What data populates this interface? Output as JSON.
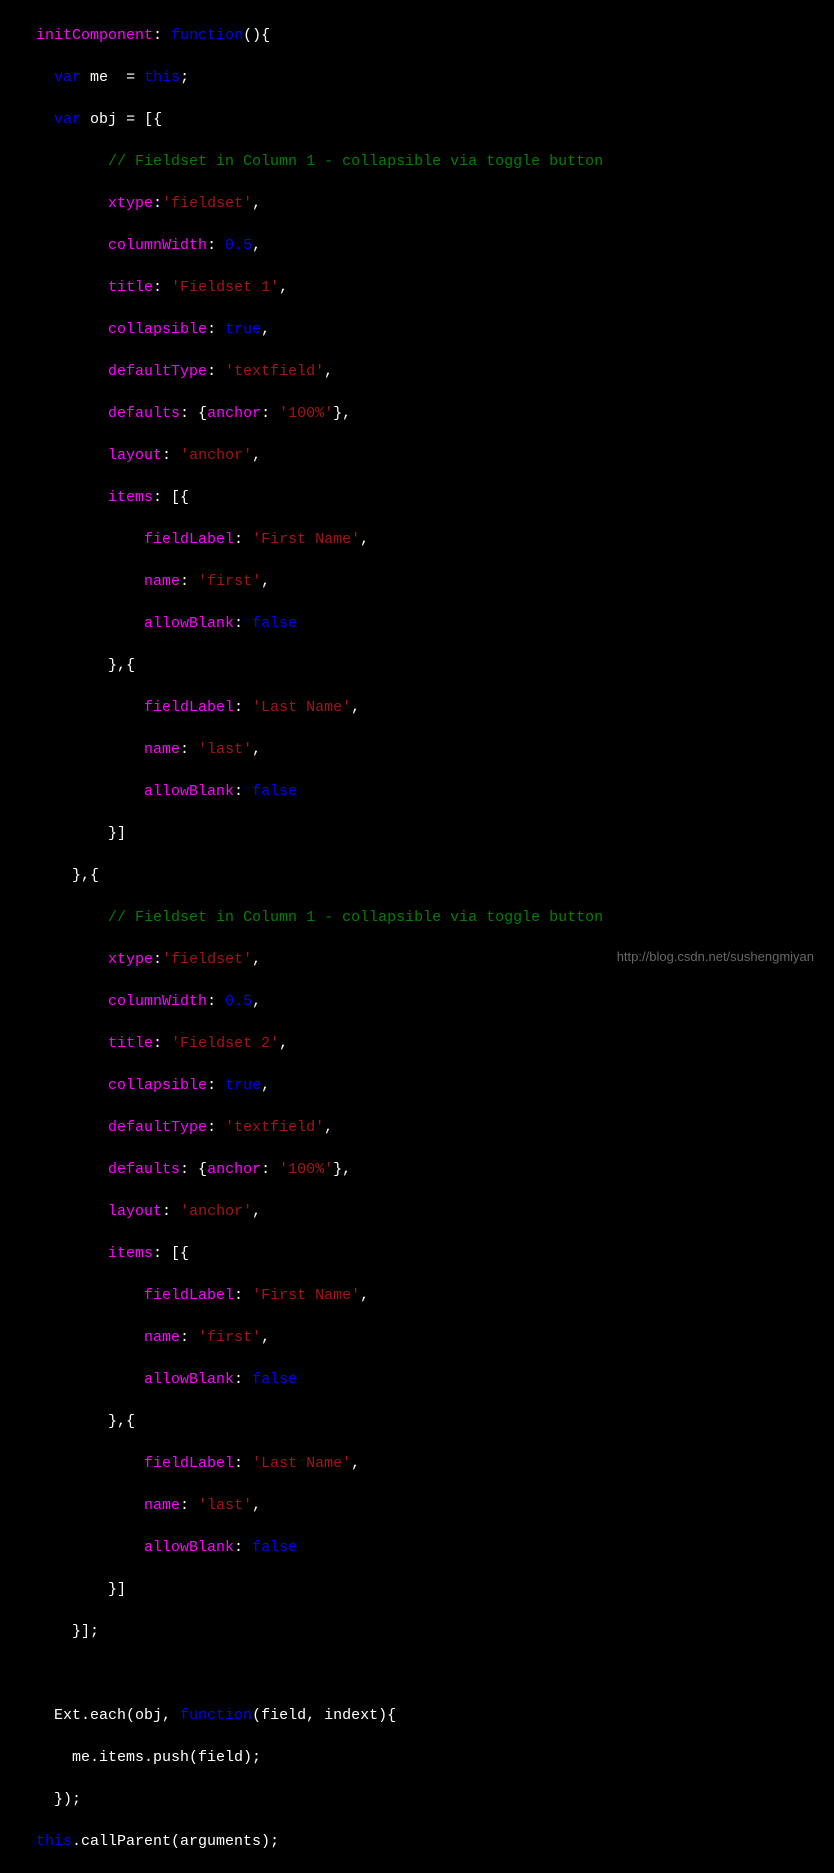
{
  "code": {
    "line1_prop": "initComponent",
    "line1_func": "function",
    "line2_var": "var",
    "line2_me": "me",
    "line2_this": "this",
    "line3_var": "var",
    "line3_obj": "obj",
    "comment1": "// Fieldset in Column 1 - collapsible via toggle button",
    "xtype_prop": "xtype",
    "xtype_val": "'fieldset'",
    "columnWidth_prop": "columnWidth",
    "columnWidth_val": "0.5",
    "title_prop": "title",
    "title1_val": "'Fieldset 1'",
    "title2_val": "'Fieldset 2'",
    "collapsible_prop": "collapsible",
    "collapsible_val": "true",
    "defaultType_prop": "defaultType",
    "defaultType_val": "'textfield'",
    "defaults_prop": "defaults",
    "anchor_prop": "anchor",
    "anchor_val": "'100%'",
    "layout_prop": "layout",
    "layout_val": "'anchor'",
    "items_prop": "items",
    "fieldLabel_prop": "fieldLabel",
    "firstName_val": "'First Name'",
    "lastName_val": "'Last Name'",
    "name_prop": "name",
    "first_val": "'first'",
    "last_val": "'last'",
    "allowBlank_prop": "allowBlank",
    "allowBlank_val": "false",
    "comment2": "// Fieldset in Column 1 - collapsible via toggle button",
    "ext_each": "Ext.each(obj, ",
    "function_kw": "function",
    "each_params": "(field, indext){",
    "push_line": "me.items.push(field);",
    "close_each": "});",
    "this_kw": "this",
    "callParent": ".callParent(arguments);"
  },
  "watermark": "http://blog.csdn.net/sushengmiyan"
}
